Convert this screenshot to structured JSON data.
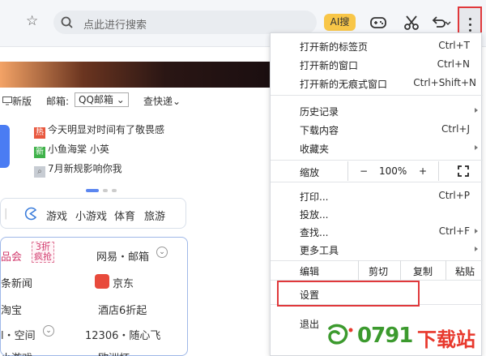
{
  "toolbar": {
    "omnibox_placeholder": "点此进行搜索",
    "ai_label": "AI搜"
  },
  "page": {
    "nav": {
      "new_version": "新版",
      "mail_label": "邮箱:",
      "mail_select": "QQ邮箱",
      "check_express": "查快递"
    },
    "hot": [
      {
        "tag": "热",
        "tag_color": "#e8583f",
        "text": "今天明显对时间有了敬畏感"
      },
      {
        "tag": "新",
        "tag_color": "#3fb24a",
        "text": "小鱼海棠 小英"
      },
      {
        "tag": "",
        "tag_color": "#c7ccd3",
        "text": "7月新规影响你我"
      }
    ],
    "games": [
      "游戏",
      "小游戏",
      "体育",
      "旅游"
    ],
    "sites": {
      "r1a": "品会",
      "promo": "3折疯抢",
      "r1b": "网易・邮箱",
      "r2a": "条新闻",
      "r2b": "京东",
      "r3a": "淘宝",
      "r3b": "酒店6折起",
      "r4a": "l・空间",
      "r4b": "12306・随心飞",
      "r5a": "小游戏",
      "r5b": "欧洲杯"
    }
  },
  "menu": {
    "new_tab": "打开新的标签页",
    "new_tab_sc": "Ctrl+T",
    "new_window": "打开新的窗口",
    "new_window_sc": "Ctrl+N",
    "incognito": "打开新的无痕式窗口",
    "incognito_sc": "Ctrl+Shift+N",
    "history": "历史记录",
    "downloads": "下载内容",
    "downloads_sc": "Ctrl+J",
    "bookmarks": "收藏夹",
    "zoom": "缩放",
    "zoom_minus": "−",
    "zoom_level": "100%",
    "zoom_plus": "+",
    "print": "打印...",
    "print_sc": "Ctrl+P",
    "cast": "投放...",
    "find": "查找...",
    "find_sc": "Ctrl+F",
    "more_tools": "更多工具",
    "edit": "编辑",
    "cut": "剪切",
    "copy": "复制",
    "paste": "粘贴",
    "settings": "设置",
    "exit": "退出"
  },
  "watermark": {
    "number": "0791",
    "text": "下载站"
  },
  "colors": {
    "highlight": "#e0383b",
    "accent": "#4a7cf3"
  }
}
